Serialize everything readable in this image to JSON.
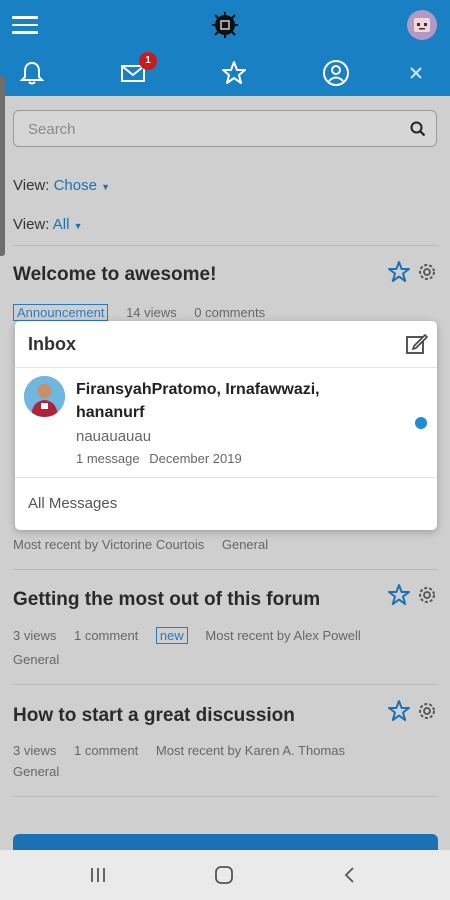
{
  "app": {
    "logo_icon": "app-logo-icon"
  },
  "notifications": {
    "unread_messages": "1"
  },
  "search": {
    "placeholder": "Search"
  },
  "filters": [
    {
      "label": "View:",
      "value": "Chose"
    },
    {
      "label": "View:",
      "value": "All"
    }
  ],
  "posts": [
    {
      "title": "Welcome to awesome!",
      "tag": "Announcement",
      "views": "14 views",
      "comments": "0 comments",
      "recent": "Most recent by Victorine Courtois",
      "category": "General"
    },
    {
      "title": "Getting the most out of this forum",
      "views": "3 views",
      "comments": "1 comment",
      "badge": "new",
      "recent": "Most recent by Alex Powell",
      "category": "General"
    },
    {
      "title": "How to start a great discussion",
      "views": "3 views",
      "comments": "1 comment",
      "recent": "Most recent by Karen A. Thomas",
      "category": "General"
    }
  ],
  "inbox": {
    "title": "Inbox",
    "message": {
      "from": "FiransyahPratomo, Irnafawwazi, hananurf",
      "preview": "nauauauau",
      "count": "1 message",
      "date": "December 2019"
    },
    "all_link": "All Messages"
  },
  "colors": {
    "header": "#1a80c4",
    "accent": "#1a72b5",
    "badge": "#c81c1c",
    "unread": "#1f8ad6"
  }
}
